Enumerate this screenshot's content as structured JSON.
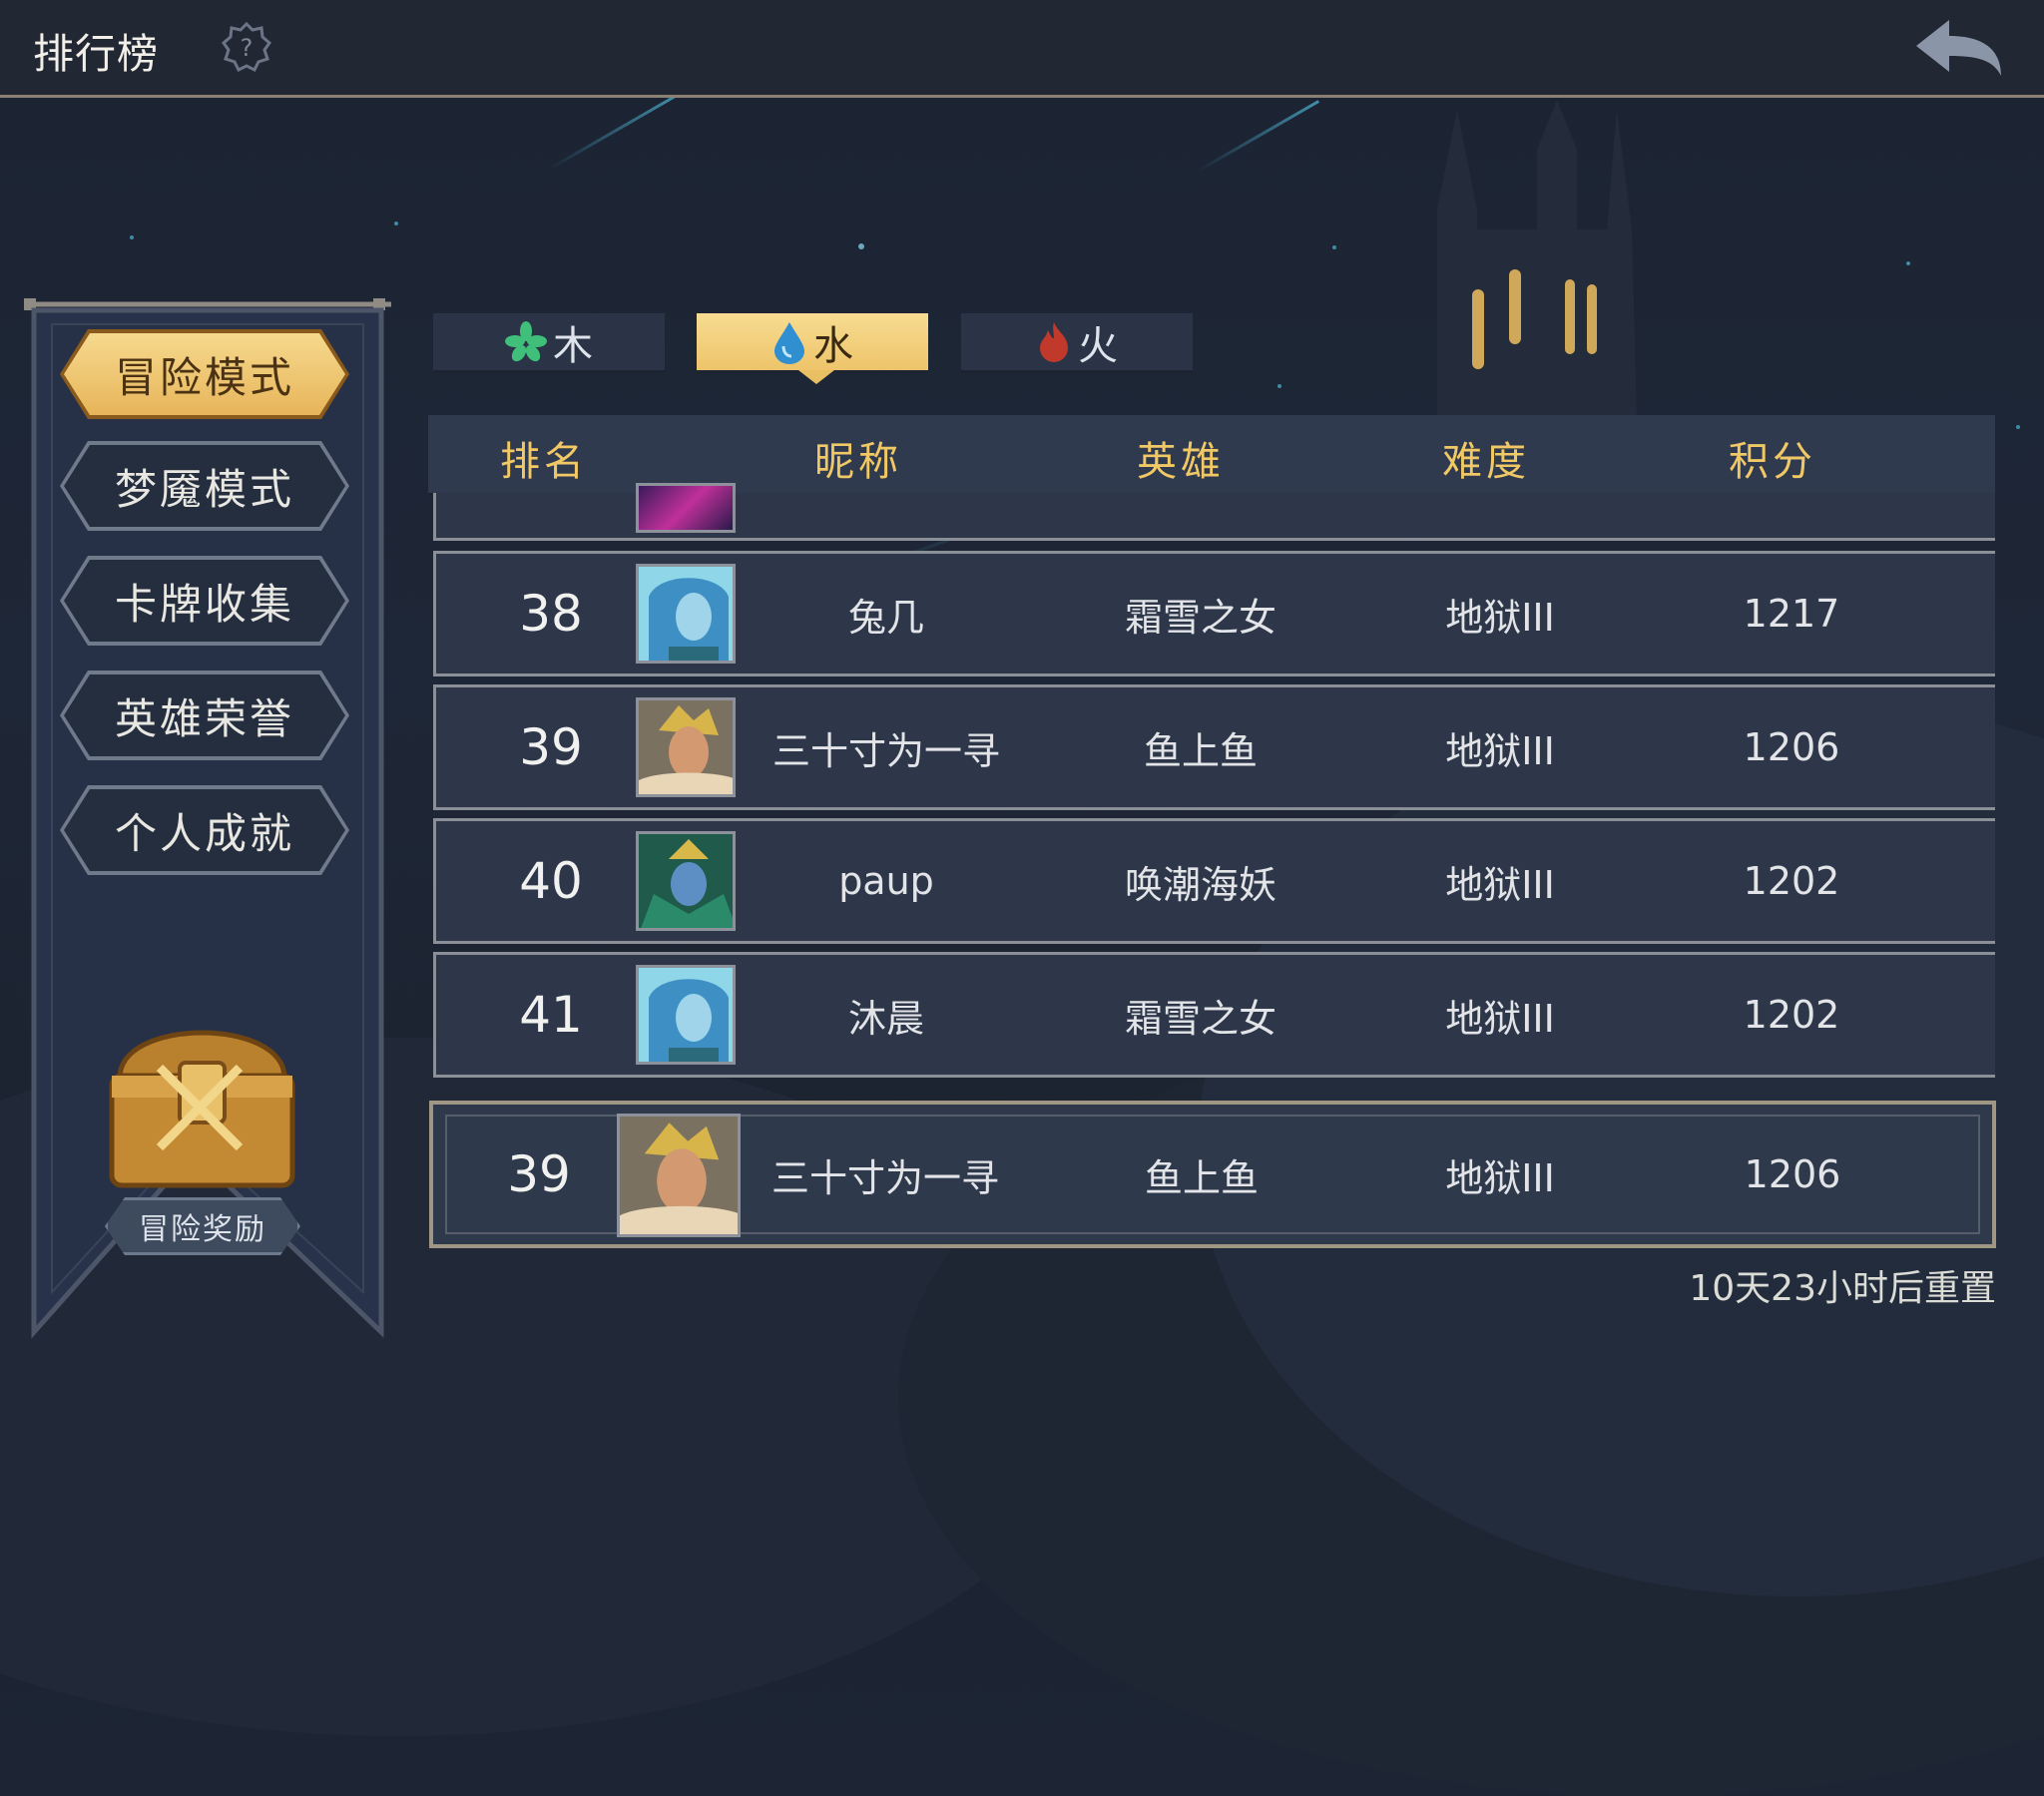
{
  "header": {
    "title": "排行榜",
    "help_icon": "question-gear-icon",
    "back_icon": "back-arrow-icon"
  },
  "sidebar": {
    "modes": [
      {
        "label": "冒险模式",
        "active": true
      },
      {
        "label": "梦魇模式",
        "active": false
      },
      {
        "label": "卡牌收集",
        "active": false
      },
      {
        "label": "英雄荣誉",
        "active": false
      },
      {
        "label": "个人成就",
        "active": false
      }
    ],
    "reward_label": "冒险奖励"
  },
  "tabs": [
    {
      "label": "木",
      "icon": "leaf-icon",
      "active": false
    },
    {
      "label": "水",
      "icon": "water-drop-icon",
      "active": true
    },
    {
      "label": "火",
      "icon": "fire-icon",
      "active": false
    }
  ],
  "table": {
    "columns": [
      "排名",
      "昵称",
      "英雄",
      "难度",
      "积分"
    ],
    "rows": [
      {
        "rank": "38",
        "name": "兔几",
        "hero": "霜雪之女",
        "difficulty": "地狱III",
        "score": "1217",
        "avatar": "frost-maiden"
      },
      {
        "rank": "39",
        "name": "三十寸为一寻",
        "hero": "鱼上鱼",
        "difficulty": "地狱III",
        "score": "1206",
        "avatar": "fish-hero"
      },
      {
        "rank": "40",
        "name": "paup",
        "hero": "唤潮海妖",
        "difficulty": "地狱III",
        "score": "1202",
        "avatar": "tide-siren"
      },
      {
        "rank": "41",
        "name": "沐晨",
        "hero": "霜雪之女",
        "difficulty": "地狱III",
        "score": "1202",
        "avatar": "frost-maiden"
      }
    ],
    "my_row": {
      "rank": "39",
      "name": "三十寸为一寻",
      "hero": "鱼上鱼",
      "difficulty": "地狱III",
      "score": "1206",
      "avatar": "fish-hero"
    }
  },
  "reset_text": "10天23小时后重置",
  "colors": {
    "accent_gold": "#f0c866",
    "active_tab": "#eec46a",
    "panel": "#2d3749"
  }
}
